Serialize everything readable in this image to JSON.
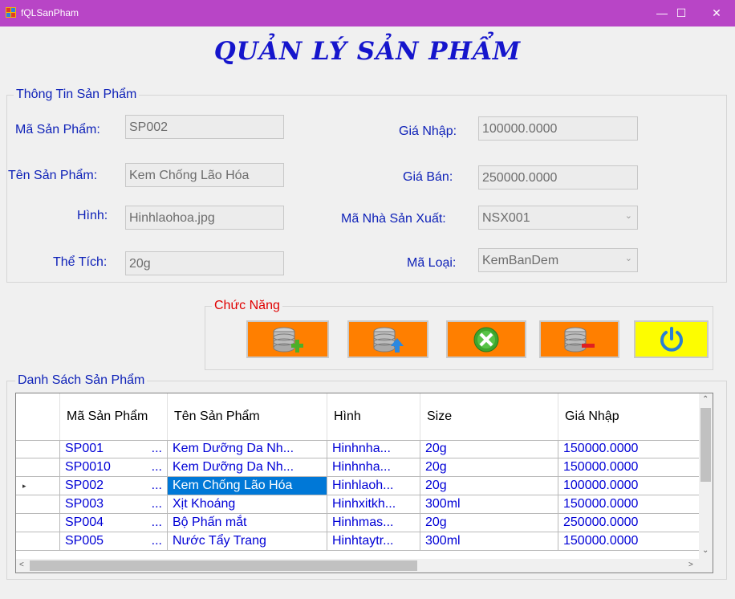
{
  "window": {
    "title": "fQLSanPham",
    "minimize": "—",
    "maximize": "☐",
    "close": "✕"
  },
  "heading": "QUẢN LÝ SẢN PHẨM",
  "info": {
    "legend": "Thông Tin Sản Phẩm",
    "ma_sp_label": "Mã Sản Phẩm:",
    "ma_sp_value": "SP002",
    "ten_sp_label": "Tên Sản Phẩm:",
    "ten_sp_value": "Kem Chống Lão Hóa",
    "hinh_label": "Hình:",
    "hinh_value": "Hinhlaohoa.jpg",
    "the_tich_label": "Thể Tích:",
    "the_tich_value": "20g",
    "gia_nhap_label": "Giá Nhập:",
    "gia_nhap_value": "100000.0000",
    "gia_ban_label": "Giá Bán:",
    "gia_ban_value": "250000.0000",
    "ma_nsx_label": "Mã Nhà Sản Xuất:",
    "ma_nsx_value": "NSX001",
    "ma_loai_label": "Mã Loại:",
    "ma_loai_value": "KemBanDem"
  },
  "functions": {
    "legend": "Chức Năng",
    "buttons": [
      {
        "icon": "database-add-icon"
      },
      {
        "icon": "database-update-icon"
      },
      {
        "icon": "tools-icon"
      },
      {
        "icon": "database-delete-icon"
      },
      {
        "icon": "power-icon"
      }
    ],
    "colors": {
      "orange": "#ff7f00",
      "yellow": "#fdfd00"
    }
  },
  "list": {
    "legend": "Danh Sách Sản Phẩm",
    "columns": [
      "Mã Sản Phẩm",
      "Tên Sản Phẩm",
      "Hình",
      "Size",
      "Giá Nhập"
    ],
    "rows": [
      {
        "ma": "SP001",
        "more": "...",
        "ten": "Kem Dưỡng Da Nh...",
        "hinh": "Hinhnha...",
        "size": "20g",
        "gia": "150000.0000",
        "current": ""
      },
      {
        "ma": "SP0010",
        "more": "...",
        "ten": "Kem Dưỡng Da Nh...",
        "hinh": "Hinhnha...",
        "size": "20g",
        "gia": "150000.0000",
        "current": ""
      },
      {
        "ma": "SP002",
        "more": "...",
        "ten": "Kem Chống Lão Hóa",
        "hinh": "Hinhlaoh...",
        "size": "20g",
        "gia": "100000.0000",
        "current": "▸"
      },
      {
        "ma": "SP003",
        "more": "...",
        "ten": "Xịt Khoáng",
        "hinh": "Hinhxitkh...",
        "size": "300ml",
        "gia": "150000.0000",
        "current": ""
      },
      {
        "ma": "SP004",
        "more": "...",
        "ten": "Bộ Phấn mắt",
        "hinh": "Hinhmas...",
        "size": "20g",
        "gia": "250000.0000",
        "current": ""
      },
      {
        "ma": "SP005",
        "more": "...",
        "ten": "Nước Tẩy Trang",
        "hinh": "Hinhtaytr...",
        "size": "300ml",
        "gia": "150000.0000",
        "current": ""
      }
    ],
    "selected_color": "#0078d7"
  }
}
